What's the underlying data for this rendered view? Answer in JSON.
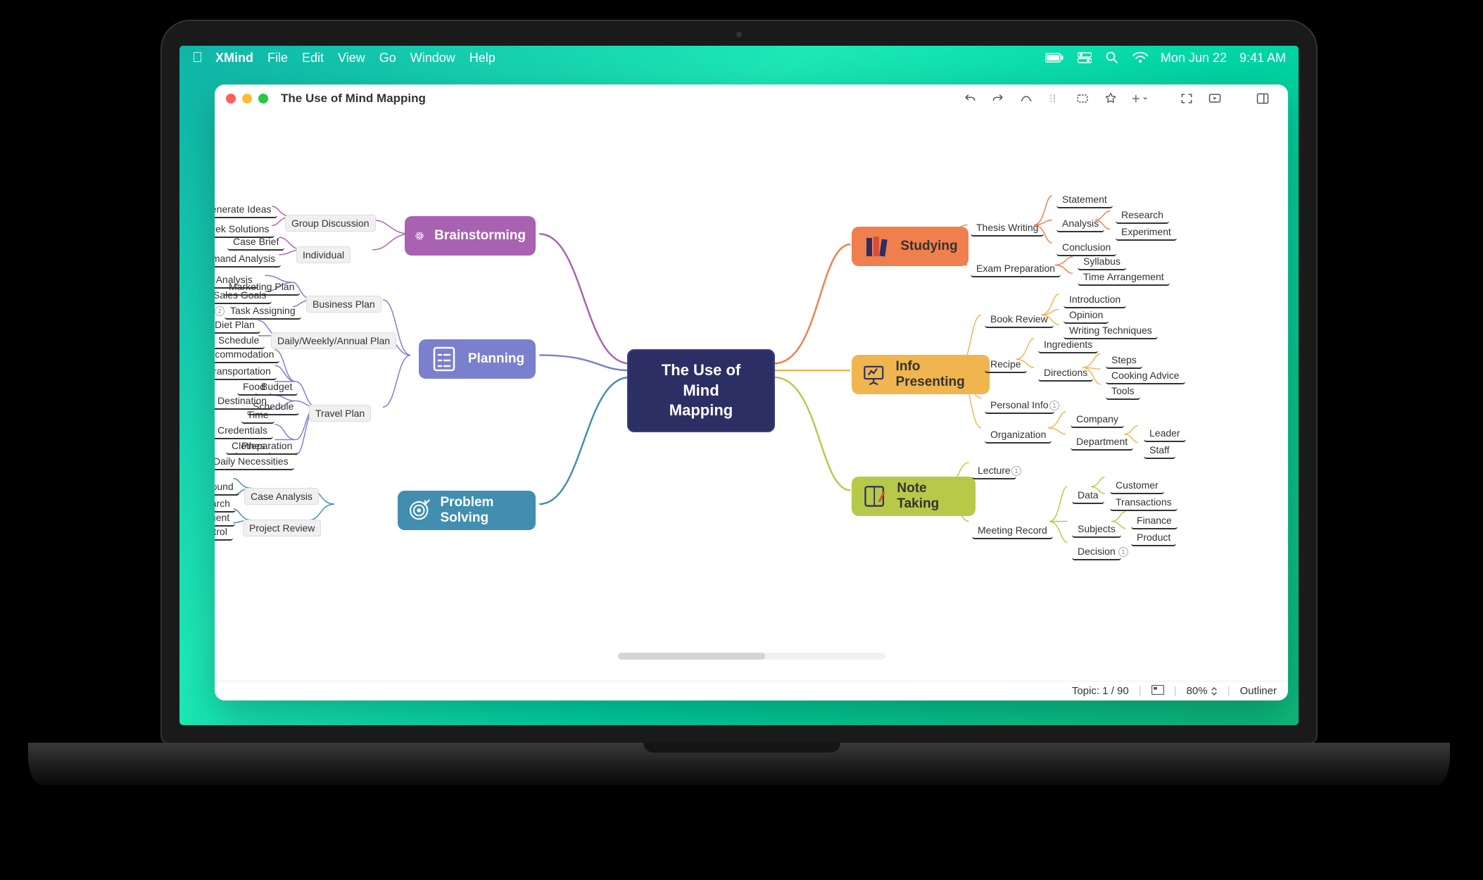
{
  "menubar": {
    "app": "XMind",
    "items": [
      "File",
      "Edit",
      "View",
      "Go",
      "Window",
      "Help"
    ],
    "date": "Mon Jun 22",
    "time": "9:41 AM"
  },
  "window": {
    "title": "The Use of Mind Mapping"
  },
  "central": "The Use of Mind\nMapping",
  "topics": {
    "brainstorming": {
      "label": "Brainstorming"
    },
    "planning": {
      "label": "Planning"
    },
    "problem": {
      "label": "Problem Solving"
    },
    "studying": {
      "label": "Studying"
    },
    "info": {
      "label": "Info Presenting"
    },
    "note": {
      "label": "Note Taking"
    }
  },
  "subs": {
    "groupDiscussion": "Group Discussion",
    "individual": "Individual",
    "generateIdeas": "Generate Ideas",
    "seekSolutions": "Seek Solutions",
    "caseBrief": "Case Brief",
    "demandAnalysis": "Demand Analysis",
    "businessPlan": "Business Plan",
    "marketingPlan": "Marketing Plan",
    "competitorAnalysis": "Competitor Analysis",
    "salesGoals": "Sales Goals",
    "taskAssigning": "Task Assigning",
    "dailyPlan": "Daily/Weekly/Annual Plan",
    "dietPlan": "Diet Plan",
    "classSchedule": "Class Schedule",
    "travelPlan": "Travel Plan",
    "budget": "Budget",
    "accommodation": "Accommodation",
    "transportation": "Transportation",
    "food": "Food",
    "schedule": "Schedule",
    "destination": "Destination",
    "time": "Time",
    "preparation": "Preparation",
    "credentials": "Credentials",
    "clothes": "Clothes",
    "dailyNecessities": "Daily Necessities",
    "caseAnalysis": "Case Analysis",
    "background": "Background",
    "research": "Research",
    "projectReview": "Project Review",
    "projectManagement": "Project Management",
    "costControl": "Cost Control",
    "thesisWriting": "Thesis Writing",
    "statement": "Statement",
    "analysis": "Analysis",
    "researchR": "Research",
    "experiment": "Experiment",
    "conclusion": "Conclusion",
    "examPrep": "Exam Preparation",
    "syllabus": "Syllabus",
    "timeArrangement": "Time Arrangement",
    "bookReview": "Book Review",
    "introduction": "Introduction",
    "opinion": "Opinion",
    "writingTech": "Writing Techniques",
    "recipe": "Recipe",
    "ingredients": "Ingredients",
    "directions": "Directions",
    "steps": "Steps",
    "cookingAdvice": "Cooking Advice",
    "tools": "Tools",
    "personalInfo": "Personal Info",
    "organization": "Organization",
    "company": "Company",
    "department": "Department",
    "leader": "Leader",
    "staff": "Staff",
    "lecture": "Lecture",
    "meetingRecord": "Meeting Record",
    "data": "Data",
    "customer": "Customer",
    "transactions": "Transactions",
    "finance": "Finance",
    "subjects": "Subjects",
    "product": "Product",
    "decision": "Decision"
  },
  "status": {
    "topic": "Topic: 1 / 90",
    "zoom": "80%",
    "outliner": "Outliner"
  },
  "colors": {
    "brainstorming": "#a862b1",
    "planning": "#7a7fce",
    "problem": "#418eb0",
    "studying": "#f07f4e",
    "info": "#f0b54e",
    "note": "#b7c948"
  }
}
